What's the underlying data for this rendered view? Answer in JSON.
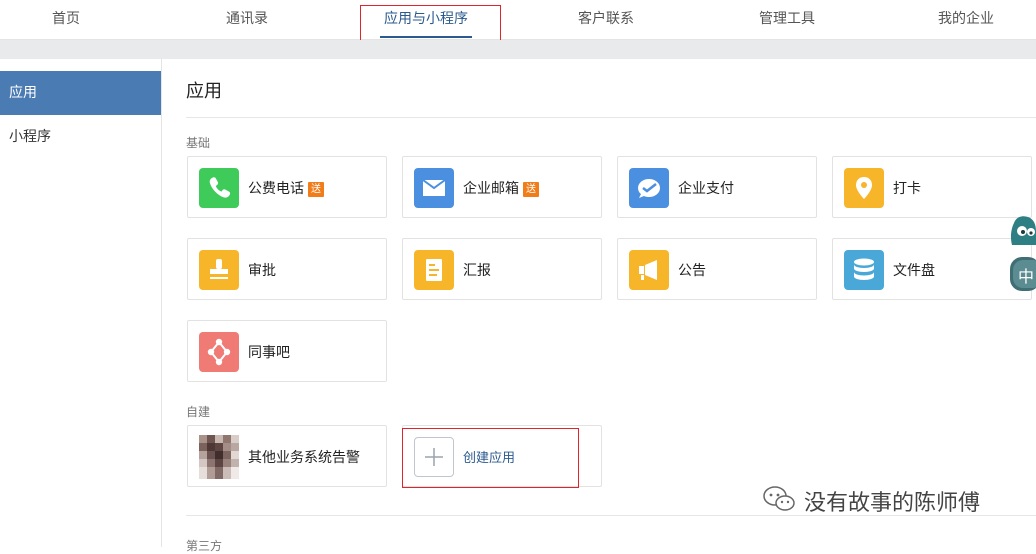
{
  "topnav": {
    "tabs": [
      {
        "label": "首页"
      },
      {
        "label": "通讯录"
      },
      {
        "label": "应用与小程序"
      },
      {
        "label": "客户联系"
      },
      {
        "label": "管理工具"
      },
      {
        "label": "我的企业"
      }
    ],
    "active_tab": "应用与小程序"
  },
  "sidebar": {
    "items": [
      {
        "label": "应用"
      },
      {
        "label": "小程序"
      }
    ],
    "active_item": "应用"
  },
  "main": {
    "title": "应用",
    "sections": {
      "basic": {
        "label": "基础",
        "apps": [
          {
            "label": "公费电话",
            "badge": "送",
            "icon": "phone-icon",
            "color": "#3fcb5a"
          },
          {
            "label": "企业邮箱",
            "badge": "送",
            "icon": "mail-icon",
            "color": "#4a8fe0"
          },
          {
            "label": "企业支付",
            "icon": "payment-icon",
            "color": "#4a8fe0"
          },
          {
            "label": "打卡",
            "icon": "location-pin-icon",
            "color": "#f7b52a"
          },
          {
            "label": "审批",
            "icon": "stamp-icon",
            "color": "#f7b52a"
          },
          {
            "label": "汇报",
            "icon": "report-doc-icon",
            "color": "#f7b52a"
          },
          {
            "label": "公告",
            "icon": "megaphone-icon",
            "color": "#f7b52a"
          },
          {
            "label": "文件盘",
            "icon": "database-icon",
            "color": "#4aa8d8"
          },
          {
            "label": "同事吧",
            "icon": "network-icon",
            "color": "#f07a74"
          }
        ]
      },
      "custom": {
        "label": "自建",
        "apps": [
          {
            "label": "其他业务系统告警",
            "icon": "pixelated-avatar"
          }
        ],
        "create_label": "创建应用"
      },
      "third_party": {
        "label": "第三方"
      }
    }
  },
  "watermark": {
    "text": "没有故事的陈师傅"
  },
  "floater": {
    "label": "中"
  },
  "colors": {
    "accent": "#2b5a8e",
    "sidebar_active": "#4b7bb3",
    "highlight_box": "#e0242b",
    "badge": "#f07c1a"
  }
}
